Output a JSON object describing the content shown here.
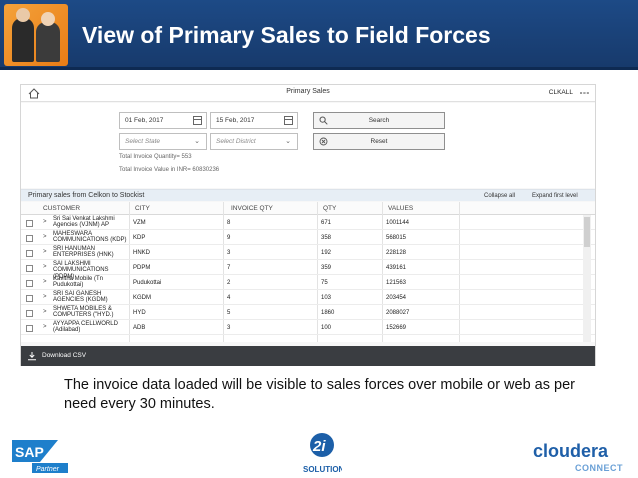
{
  "slide": {
    "title": "View of Primary Sales to Field Forces",
    "caption": "The invoice data loaded will be visible to sales forces over mobile or web as per need every 30 minutes."
  },
  "app": {
    "title": "Primary Sales",
    "user": "CLKALL",
    "filters": {
      "from_date": "01 Feb, 2017",
      "to_date": "15 Feb, 2017",
      "state_placeholder": "Select State",
      "district_placeholder": "Select District",
      "search_label": "Search",
      "reset_label": "Reset"
    },
    "summary": {
      "quantity": "Total Invoice Quantity= 553",
      "value": "Total Invoice Value in INR= 60830236"
    },
    "section": {
      "title": "Primary sales from Celkon to Stockist",
      "collapse_all": "Collapse all",
      "expand_first": "Expand first level"
    },
    "table": {
      "columns": [
        "CUSTOMER",
        "CITY",
        "INVOICE QTY",
        "QTY",
        "VALUES"
      ],
      "rows": [
        {
          "customer": "Sri Sai Venkat Lakshmi Agencies (VJNM) AP",
          "city": "VZM",
          "invoice_qty": "8",
          "qty": "671",
          "values": "1001144"
        },
        {
          "customer": "MAHESWARA COMMUNICATIONS (KDP)",
          "city": "KDP",
          "invoice_qty": "9",
          "qty": "358",
          "values": "568015"
        },
        {
          "customer": "SRI HANUMAN ENTERPRISES (HNK)",
          "city": "HNKD",
          "invoice_qty": "3",
          "qty": "192",
          "values": "228128"
        },
        {
          "customer": "SAI LAKSHMI COMMUNICATIONS (PDPM)",
          "city": "PDPM",
          "invoice_qty": "7",
          "qty": "359",
          "values": "439161"
        },
        {
          "customer": "Kavitha Mobile (Tn Pudukottai)",
          "city": "Pudukottai",
          "invoice_qty": "2",
          "qty": "75",
          "values": "121563"
        },
        {
          "customer": "SRI SAI GANESH AGENCIES (KGDM)",
          "city": "KGDM",
          "invoice_qty": "4",
          "qty": "103",
          "values": "203454"
        },
        {
          "customer": "SHWETA MOBILES & COMPUTERS (\"HYD.)",
          "city": "HYD",
          "invoice_qty": "5",
          "qty": "1860",
          "values": "2088027"
        },
        {
          "customer": "AYYAPPA CELLWORLD (Adilabad)",
          "city": "ADB",
          "invoice_qty": "3",
          "qty": "100",
          "values": "152669"
        }
      ]
    },
    "download_label": "Download CSV"
  },
  "logos": {
    "sap": "SAP",
    "sap_sub": "Partner",
    "twoi": "2i",
    "twoi_sub": "SOLUTIONS",
    "cloudera": "cloudera",
    "cloudera_sub": "CONNECT"
  }
}
